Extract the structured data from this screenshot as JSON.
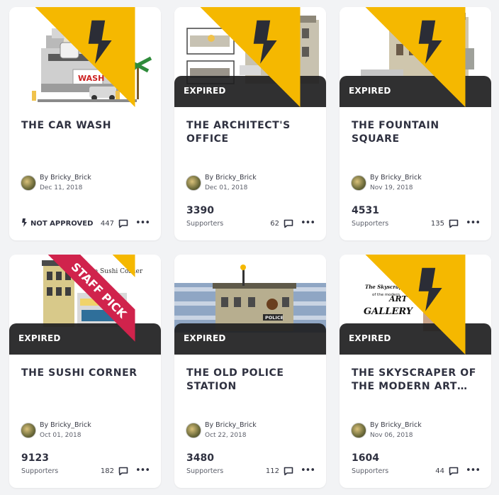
{
  "cards": [
    {
      "title": "THE CAR WASH",
      "author": "By Bricky_Brick",
      "date": "Dec 11, 2018",
      "status": "NOT APPROVED",
      "comments": "447",
      "expired_label": "",
      "staff_pick": ""
    },
    {
      "title": "THE ARCHITECT'S OFFICE",
      "author": "By Bricky_Brick",
      "date": "Dec 01, 2018",
      "supporters_count": "3390",
      "supporters_label": "Supporters",
      "comments": "62",
      "expired_label": "EXPIRED"
    },
    {
      "title": "THE FOUNTAIN SQUARE",
      "author": "By Bricky_Brick",
      "date": "Nov 19, 2018",
      "supporters_count": "4531",
      "supporters_label": "Supporters",
      "comments": "135",
      "expired_label": "EXPIRED"
    },
    {
      "title": "THE SUSHI CORNER",
      "author": "By Bricky_Brick",
      "date": "Oct 01, 2018",
      "supporters_count": "9123",
      "supporters_label": "Supporters",
      "comments": "182",
      "expired_label": "EXPIRED",
      "staff_pick": "STAFF PICK",
      "image_caption": "The Sushi Corner"
    },
    {
      "title": "THE OLD POLICE STATION",
      "author": "By Bricky_Brick",
      "date": "Oct 22, 2018",
      "supporters_count": "3480",
      "supporters_label": "Supporters",
      "comments": "112",
      "expired_label": "EXPIRED",
      "image_caption": "POLICE"
    },
    {
      "title": "THE SKYSCRAPER OF THE MODERN ART…",
      "author": "By Bricky_Brick",
      "date": "Nov 06, 2018",
      "supporters_count": "1604",
      "supporters_label": "Supporters",
      "comments": "44",
      "expired_label": "EXPIRED",
      "image_caption_lines": [
        "The Skyscraper",
        "of the modern",
        "ART",
        "GALLERY"
      ]
    }
  ],
  "colors": {
    "flag_yellow": "#f5b800",
    "staff_pick_red": "#d0234c",
    "expired_band": "#1e1e20",
    "page_bg": "#f2f3f5"
  },
  "icons": {
    "flag": "bolt-flag-icon",
    "comment": "comment-bubble-icon",
    "more": "more-dots-icon",
    "avatar": "avatar"
  }
}
